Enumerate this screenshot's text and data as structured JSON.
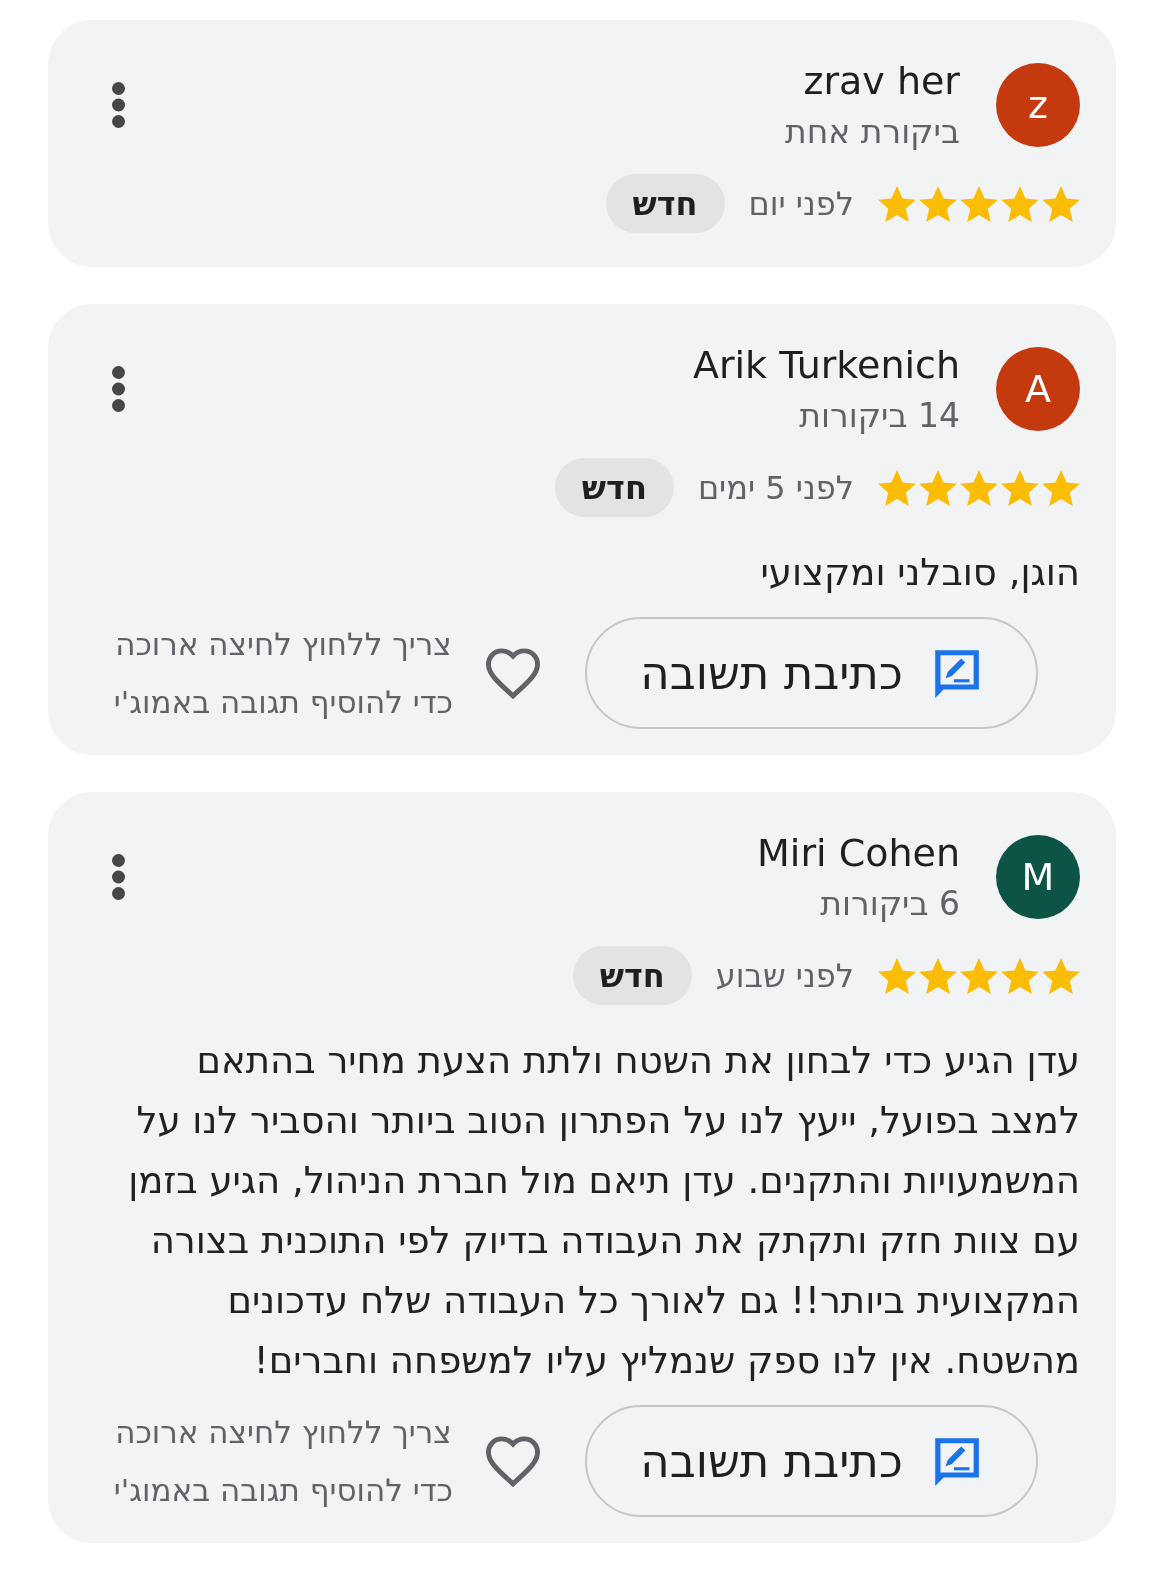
{
  "reviews": [
    {
      "author": "zrav her",
      "avatar_letter": "z",
      "color": "#c5390f",
      "review_count": "ביקורת אחת",
      "stars": 5,
      "time": "לפני יום",
      "badge": "חדש"
    },
    {
      "author": "Arik Turkenich",
      "avatar_letter": "A",
      "color": "#c5390f",
      "review_count": "14 ביקורות",
      "stars": 5,
      "time": "לפני 5 ימים",
      "badge": "חדש",
      "text": "הוגן, סובלני ומקצועי",
      "reply_button": "כתיבת תשובה",
      "liked": false,
      "reaction_hint": [
        "צריך ללחוץ לחיצה ארוכה",
        "כדי להוסיף תגובה באמוג'י"
      ]
    },
    {
      "author": "Miri Cohen",
      "avatar_letter": "M",
      "color": "#0b5446",
      "review_count": "6 ביקורות",
      "stars": 5,
      "time": "לפני שבוע",
      "badge": "חדש",
      "text": "עדן הגיע כדי לבחון את השטח ולתת הצעת מחיר בהתאם למצב בפועל, ייעץ לנו על הפתרון הטוב ביותר והסביר לנו על המשמעויות והתקנים. עדן תיאם מול חברת הניהול, הגיע בזמן עם צוות חזק ותקתק את העבודה בדיוק לפי התוכנית בצורה המקצועית ביותר!! גם לאורך כל העבודה שלח עדכונים מהשטח. אין לנו ספק שנמליץ עליו למשפחה וחברים!",
      "reply_button": "כתיבת תשובה",
      "liked": false,
      "reaction_hint": [
        "צריך ללחוץ לחיצה ארוכה",
        "כדי להוסיף תגובה באמוג'י"
      ]
    }
  ]
}
